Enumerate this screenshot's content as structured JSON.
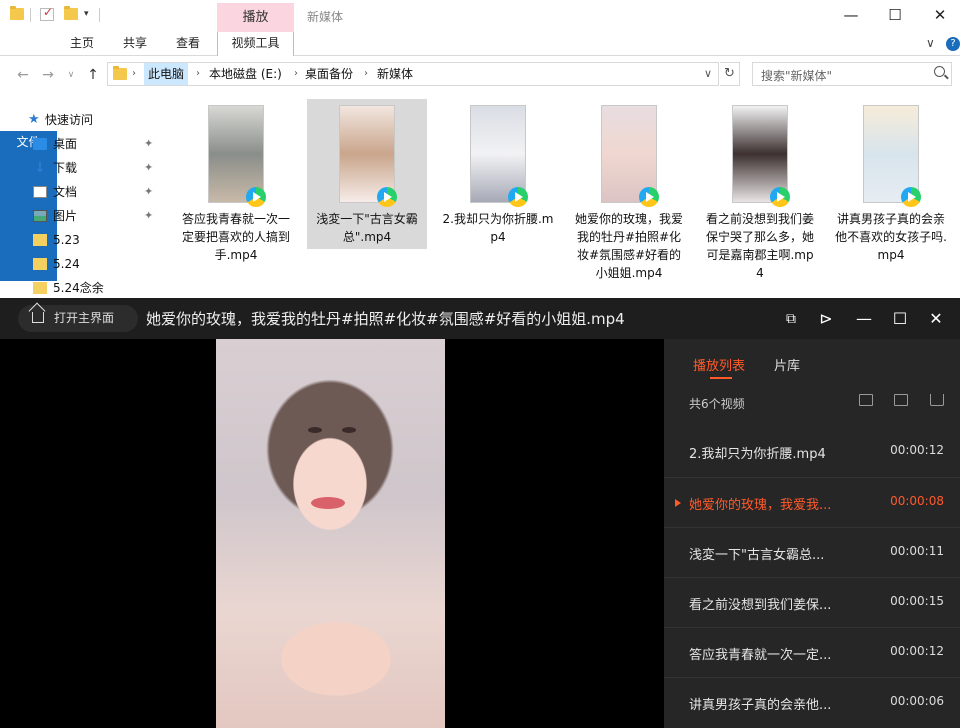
{
  "window": {
    "title": "新媒体",
    "contextual_tab_top": "播放",
    "controls": [
      "—",
      "☐",
      "✕"
    ]
  },
  "ribbon": {
    "tabs": [
      "文件",
      "主页",
      "共享",
      "查看",
      "视频工具"
    ],
    "expand": "∨"
  },
  "address": {
    "crumbs": [
      "此电脑",
      "本地磁盘 (E:)",
      "桌面备份",
      "新媒体"
    ],
    "dropdown": "∨",
    "refresh": "↻"
  },
  "search": {
    "placeholder": "搜索\"新媒体\""
  },
  "navpane": {
    "quick_access": "快速访问",
    "items": [
      {
        "label": "桌面",
        "icon": "desktop-icon",
        "pinned": true
      },
      {
        "label": "下载",
        "icon": "download-icon",
        "pinned": true
      },
      {
        "label": "文档",
        "icon": "document-icon",
        "pinned": true
      },
      {
        "label": "图片",
        "icon": "picture-icon",
        "pinned": true
      },
      {
        "label": "5.23",
        "icon": "folder-icon",
        "pinned": false
      },
      {
        "label": "5.24",
        "icon": "folder-icon",
        "pinned": false
      },
      {
        "label": "5.24念余",
        "icon": "folder-icon",
        "pinned": false
      }
    ]
  },
  "files": [
    {
      "name": "答应我青春就一次一定要把喜欢的人搞到手.mp4",
      "thumb": [
        "#d8d8d4",
        "#8a8e8a",
        "#c8b9a8"
      ],
      "selected": false
    },
    {
      "name": "浅変一下\"古言女霸总\".mp4",
      "thumb": [
        "#f2e6df",
        "#c9a58c",
        "#f6ece8"
      ],
      "selected": true
    },
    {
      "name": "2.我却只为你折腰.mp4",
      "thumb": [
        "#d9dde4",
        "#f2f2f4",
        "#a6a9b6"
      ],
      "selected": false
    },
    {
      "name": "她爱你的玫瑰，我爱我的牡丹#拍照#化妆#氛围感#好看的小姐姐.mp4",
      "thumb": [
        "#e8dde0",
        "#f0d7d0",
        "#dbc4c4"
      ],
      "selected": false
    },
    {
      "name": "看之前没想到我们姜保宁哭了那么多，她可是嘉南郡主啊.mp4",
      "thumb": [
        "#f2f2f2",
        "#3c3030",
        "#e9e4e4"
      ],
      "selected": false
    },
    {
      "name": "讲真男孩子真的会亲他不喜欢的女孩子吗.mp4",
      "thumb": [
        "#f6ecd9",
        "#d8e4ec",
        "#e6edf2"
      ],
      "selected": false
    }
  ],
  "player": {
    "home_button": "打开主界面",
    "title": "她爱你的玫瑰，我爱我的牡丹#拍照#化妆#氛围感#好看的小姐姐.mp4",
    "tabs": [
      "播放列表",
      "片库"
    ],
    "count": "共6个视频",
    "playlist": [
      {
        "title": "2.我却只为你折腰.mp4",
        "duration": "00:00:12",
        "playing": false
      },
      {
        "title": "她爱你的玫瑰，我爱我...",
        "duration": "00:00:08",
        "playing": true
      },
      {
        "title": "浅変一下\"古言女霸总...",
        "duration": "00:00:11",
        "playing": false
      },
      {
        "title": "看之前没想到我们姜保...",
        "duration": "00:00:15",
        "playing": false
      },
      {
        "title": "答应我青春就一次一定...",
        "duration": "00:00:12",
        "playing": false
      },
      {
        "title": "讲真男孩子真的会亲他...",
        "duration": "00:00:06",
        "playing": false
      }
    ]
  },
  "colors": {
    "accent_blue": "#1a6dbd",
    "context_pink": "#fbd6e0",
    "player_accent": "#ff5a2a"
  }
}
